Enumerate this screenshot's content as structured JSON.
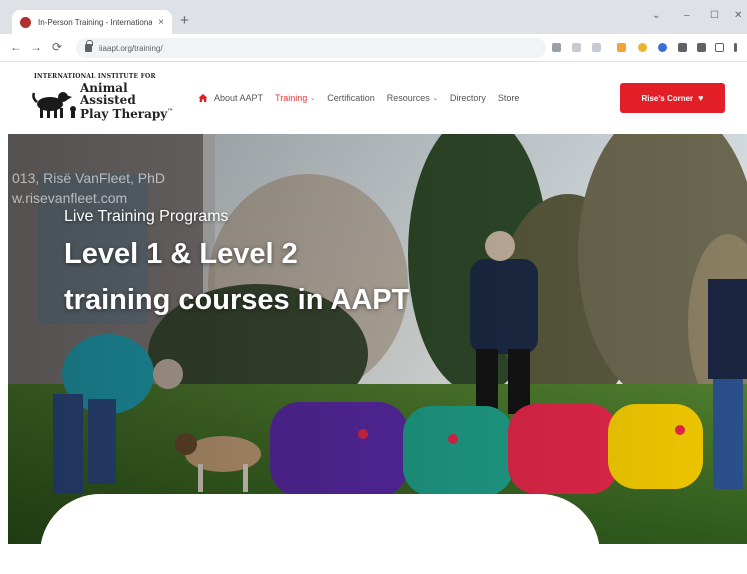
{
  "browser": {
    "tab_title": "In-Person Training - International Institute",
    "tab_close": "×",
    "new_tab": "+",
    "url": "iiaapt.org/training/",
    "nav": {
      "back": "←",
      "forward": "→",
      "reload": "⟳"
    },
    "window_controls": {
      "collapse": "⌄",
      "minimize": "–",
      "maximize": "☐",
      "close": "✕"
    }
  },
  "site": {
    "logo": {
      "org": "INTERNATIONAL INSTITUTE FOR",
      "line1": "Animal",
      "line2": "Assisted",
      "line3": "Play Therapy",
      "mark": "™"
    },
    "nav": [
      {
        "label": "About AAPT",
        "icon": "home-icon",
        "dropdown": false
      },
      {
        "label": "Training",
        "dropdown": true,
        "active": true
      },
      {
        "label": "Certification",
        "dropdown": false
      },
      {
        "label": "Resources",
        "dropdown": true
      },
      {
        "label": "Directory",
        "dropdown": false
      },
      {
        "label": "Store",
        "dropdown": false
      }
    ],
    "nav_caret": "⌄",
    "cta": {
      "label": "Rise's Corner",
      "icon": "heart-icon",
      "icon_char": "♥"
    },
    "colors": {
      "accent": "#e21f26",
      "active_nav": "#e03a3a"
    }
  },
  "hero": {
    "watermark": [
      "013, Risë VanFleet, PhD",
      "w.risevanfleet.com"
    ],
    "eyebrow": "Live Training Programs",
    "title_line1": "Level 1 & Level 2",
    "title_line2": "training courses in AAPT"
  }
}
